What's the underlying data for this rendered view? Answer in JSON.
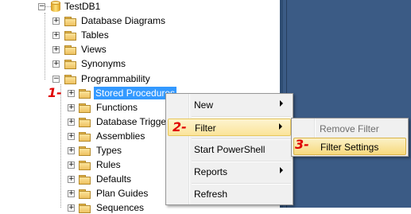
{
  "tree": {
    "root": {
      "label": "TestDB1"
    },
    "items": [
      {
        "label": "Database Diagrams"
      },
      {
        "label": "Tables"
      },
      {
        "label": "Views"
      },
      {
        "label": "Synonyms"
      },
      {
        "label": "Programmability"
      }
    ],
    "programmability_children": [
      {
        "label": "Stored Procedures"
      },
      {
        "label": "Functions"
      },
      {
        "label": "Database Trigger"
      },
      {
        "label": "Assemblies"
      },
      {
        "label": "Types"
      },
      {
        "label": "Rules"
      },
      {
        "label": "Defaults"
      },
      {
        "label": "Plan Guides"
      },
      {
        "label": "Sequences"
      }
    ]
  },
  "context_menu": {
    "items": [
      {
        "label": "New"
      },
      {
        "label": "Filter"
      },
      {
        "label": "Start PowerShell"
      },
      {
        "label": "Reports"
      },
      {
        "label": "Refresh"
      }
    ]
  },
  "filter_submenu": {
    "items": [
      {
        "label": "Remove Filter"
      },
      {
        "label": "Filter Settings"
      }
    ]
  },
  "steps": [
    "1-",
    "2-",
    "3-"
  ],
  "colors": {
    "selection": "#3399ff",
    "step_red": "#e00000",
    "right_pane": "#3b5b85",
    "menu_bg": "#f0f0f0"
  },
  "icons": [
    "database-icon",
    "folder-icon",
    "expand-icon",
    "collapse-icon",
    "submenu-arrow-icon"
  ]
}
